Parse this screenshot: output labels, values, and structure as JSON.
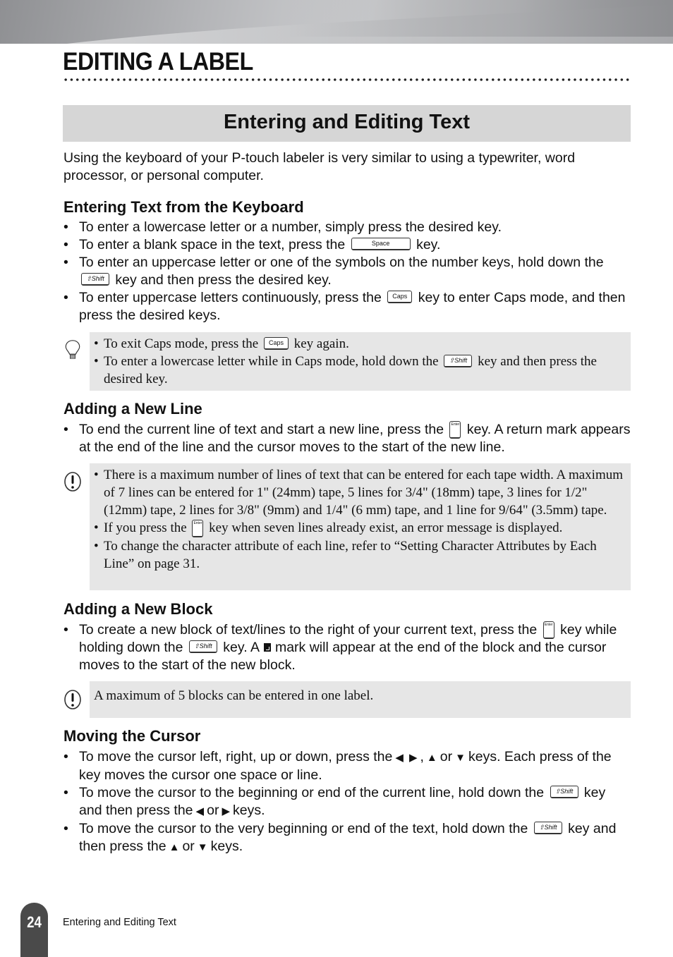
{
  "chapter": {
    "title": "EDITING A LABEL"
  },
  "section": {
    "title": "Entering and Editing Text"
  },
  "intro": "Using the keyboard of your P-touch labeler is very similar to using a typewriter, word processor, or personal computer.",
  "keys": {
    "space": "Space",
    "shift": "⇧Shift",
    "caps": "Caps",
    "enter": "Enter"
  },
  "entering": {
    "heading": "Entering Text from the Keyboard",
    "b1": "To enter a lowercase letter or a number, simply press the desired key.",
    "b2_pre": "To enter a blank space in the text, press the",
    "b2_post": "key.",
    "b3_pre": "To enter an uppercase letter or one of the symbols on the number keys, hold down the",
    "b3_post": "key and then press the desired key.",
    "b4_pre": "To enter uppercase letters continuously, press the",
    "b4_post": "key to enter Caps mode, and then press the desired keys.",
    "tip": {
      "t1_pre": "To exit Caps mode, press the",
      "t1_post": "key again.",
      "t2_pre": "To enter a lowercase letter while in Caps mode, hold down the",
      "t2_post": "key and then press the desired key."
    }
  },
  "newline": {
    "heading": "Adding a New Line",
    "b1_pre": "To end the current line of text and start a new line, press the",
    "b1_post": "key. A return mark appears at the end of the line and the cursor moves to the start of the new line.",
    "note": {
      "n1": "There is a maximum number of lines of text that can be entered for each tape width. A maximum of 7 lines can be entered for 1\" (24mm) tape, 5 lines for 3/4\" (18mm) tape, 3 lines for 1/2\" (12mm) tape, 2 lines for 3/8\" (9mm) and 1/4\" (6 mm) tape, and 1 line for 9/64\" (3.5mm) tape.",
      "n2_pre": "If you press the",
      "n2_post": "key when seven lines already exist, an error message is displayed.",
      "n3": "To change the character attribute of each line, refer to “Setting Character Attributes by Each Line” on page 31."
    }
  },
  "newblock": {
    "heading": "Adding a New Block",
    "b1_a": "To create a new block of text/lines to the right of your current text, press the",
    "b1_b": "key while holding down the",
    "b1_c": "key. A",
    "b1_d": "mark will appear at the end of the block and the cursor moves to the start of the new block.",
    "note": "A maximum of 5 blocks can be entered in one label."
  },
  "cursor": {
    "heading": "Moving the Cursor",
    "b1_a": "To move the cursor left, right, up or down, press the",
    "b1_b": "or",
    "b1_c": "keys. Each press of the key moves the cursor one space or line.",
    "b2_a": "To move the cursor to the beginning or end of the current line, hold down the",
    "b2_b": "key and then press the",
    "b2_c": "or",
    "b2_d": "keys.",
    "b3_a": "To move the cursor to the very beginning or end of the text, hold down the",
    "b3_b": "key and then press the",
    "b3_c": "or",
    "b3_d": "keys."
  },
  "arrows": {
    "left": "◀",
    "right": "▶",
    "up": "▲",
    "down": "▼"
  },
  "footer": {
    "page_number": "24",
    "text": "Entering and Editing Text"
  }
}
